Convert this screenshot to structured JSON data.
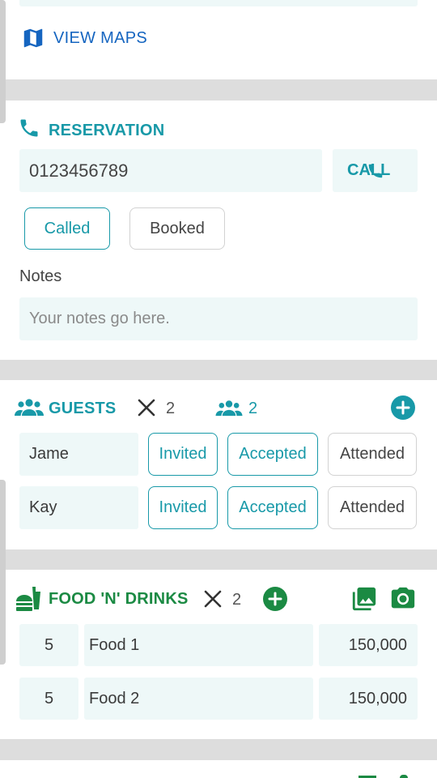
{
  "colors": {
    "accent": "#1899a8",
    "food": "#1b8a43",
    "band": "#dddddd",
    "field_bg": "#eef8f8"
  },
  "location": {
    "view_maps_label": "VIEW MAPS",
    "icon": "map-icon"
  },
  "reservation": {
    "title": "RESERVATION",
    "phone": "0123456789",
    "call_label": "CALL",
    "statuses": [
      "Called",
      "Booked"
    ],
    "notes_label": "Notes",
    "notes_placeholder": "Your notes go here."
  },
  "guests": {
    "title": "GUESTS",
    "count": "2",
    "group_count": "2",
    "rows": [
      {
        "name": "Jame",
        "invited": "Invited",
        "accepted": "Accepted",
        "attended": "Attended"
      },
      {
        "name": "Kay",
        "invited": "Invited",
        "accepted": "Accepted",
        "attended": "Attended"
      }
    ]
  },
  "food": {
    "title": "FOOD 'N' DRINKS",
    "count": "2",
    "rows": [
      {
        "qty": "5",
        "name": "Food 1",
        "price": "150,000"
      },
      {
        "qty": "5",
        "name": "Food 2",
        "price": "150,000"
      }
    ]
  }
}
